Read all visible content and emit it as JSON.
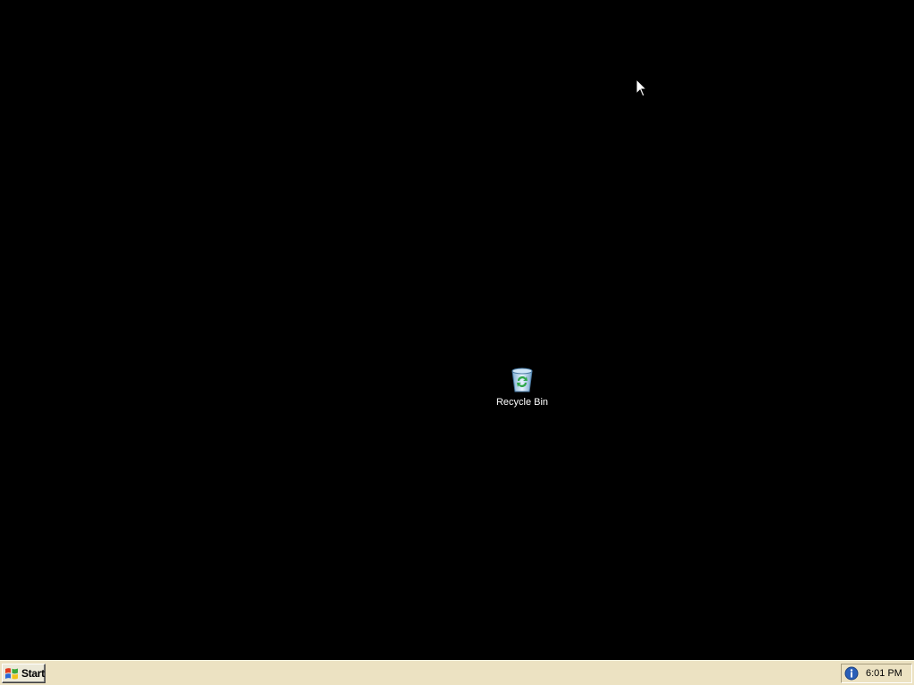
{
  "desktop": {
    "background_color": "#000000",
    "icons": [
      {
        "label": "Recycle Bin",
        "icon": "recycle-bin-icon"
      }
    ]
  },
  "taskbar": {
    "background_color": "#ece2c2",
    "start_button": {
      "label": "Start",
      "icon": "windows-logo-icon"
    },
    "tray": {
      "icons": [
        "info-icon"
      ],
      "clock": "6:01 PM"
    }
  },
  "cursor": {
    "icon": "mouse-pointer-icon"
  }
}
